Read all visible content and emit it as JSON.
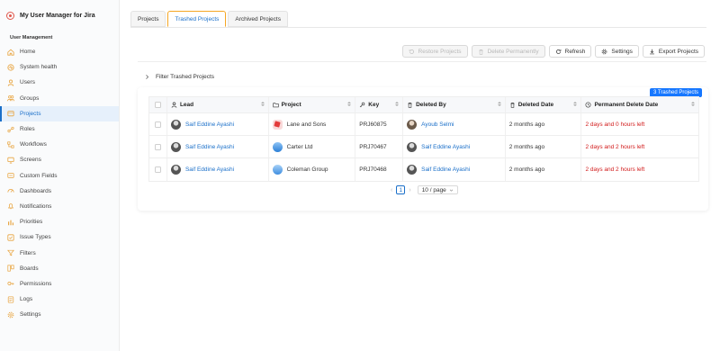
{
  "app": {
    "title": "My User Manager for Jira"
  },
  "sidebar": {
    "section_title": "User Management",
    "items": [
      {
        "label": "Home",
        "icon": "home-icon"
      },
      {
        "label": "System health",
        "icon": "health-icon"
      },
      {
        "label": "Users",
        "icon": "user-icon"
      },
      {
        "label": "Groups",
        "icon": "groups-icon"
      },
      {
        "label": "Projects",
        "icon": "projects-icon",
        "active": true
      },
      {
        "label": "Roles",
        "icon": "roles-icon"
      },
      {
        "label": "Workflows",
        "icon": "workflows-icon"
      },
      {
        "label": "Screens",
        "icon": "screens-icon"
      },
      {
        "label": "Custom Fields",
        "icon": "custom-fields-icon"
      },
      {
        "label": "Dashboards",
        "icon": "dashboards-icon"
      },
      {
        "label": "Notifications",
        "icon": "notifications-icon"
      },
      {
        "label": "Priorities",
        "icon": "priorities-icon"
      },
      {
        "label": "Issue Types",
        "icon": "issue-types-icon"
      },
      {
        "label": "Filters",
        "icon": "filters-icon"
      },
      {
        "label": "Boards",
        "icon": "boards-icon"
      },
      {
        "label": "Permissions",
        "icon": "permissions-icon"
      },
      {
        "label": "Logs",
        "icon": "logs-icon"
      },
      {
        "label": "Settings",
        "icon": "settings-icon"
      }
    ]
  },
  "tabs": [
    {
      "label": "Projects"
    },
    {
      "label": "Trashed Projects",
      "active": true
    },
    {
      "label": "Archived Projects"
    }
  ],
  "toolbar": {
    "restore_label": "Restore Projects",
    "delete_label": "Delete Permanently",
    "refresh_label": "Refresh",
    "settings_label": "Settings",
    "export_label": "Export Projects"
  },
  "filter": {
    "label": "Filter Trashed Projects"
  },
  "badge": {
    "label": "3 Trashed Projects"
  },
  "table": {
    "columns": {
      "lead": "Lead",
      "project": "Project",
      "key": "Key",
      "deleted_by": "Deleted By",
      "deleted_date": "Deleted Date",
      "permanent_delete_date": "Permanent Delete Date"
    },
    "rows": [
      {
        "lead": "Saif Eddine Ayashi",
        "project": "Lane and Sons",
        "key": "PRJ60875",
        "deleted_by": "Ayoub Selmi",
        "deleted_date": "2 months ago",
        "permanent_delete_date": "2 days and 0 hours left"
      },
      {
        "lead": "Saif Eddine Ayashi",
        "project": "Carter Ltd",
        "key": "PRJ70467",
        "deleted_by": "Saif Eddine Ayashi",
        "deleted_date": "2 months ago",
        "permanent_delete_date": "2 days and 2 hours left"
      },
      {
        "lead": "Saif Eddine Ayashi",
        "project": "Coleman Group",
        "key": "PRJ70468",
        "deleted_by": "Saif Eddine Ayashi",
        "deleted_date": "2 months ago",
        "permanent_delete_date": "2 days and 2 hours left"
      }
    ]
  },
  "pagination": {
    "current_page": "1",
    "page_size": "10 / page"
  },
  "colors": {
    "accent": "#1a6fc9",
    "tab_highlight": "#f5a623",
    "danger": "#d11a1a",
    "badge": "#1677ff"
  }
}
